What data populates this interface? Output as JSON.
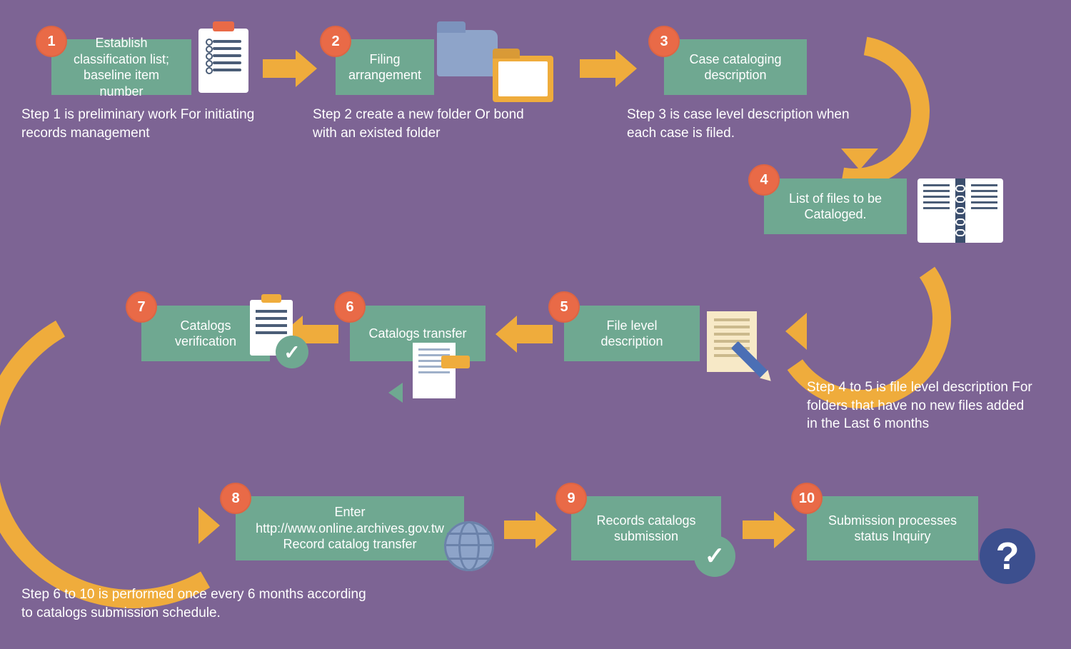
{
  "steps": {
    "s1": {
      "num": "1",
      "title": "Establish classification list; baseline item number",
      "caption": "Step 1 is preliminary work For initiating records management"
    },
    "s2": {
      "num": "2",
      "title": "Filing arrangement",
      "caption": "Step 2 create a new folder Or bond with an existed folder"
    },
    "s3": {
      "num": "3",
      "title": "Case cataloging description",
      "caption": "Step 3 is case level description when each case is filed."
    },
    "s4": {
      "num": "4",
      "title": "List of files to be Cataloged."
    },
    "s5": {
      "num": "5",
      "title": "File level description",
      "caption45": "Step 4 to 5 is file level description For folders that have no new files added in the Last 6 months"
    },
    "s6": {
      "num": "6",
      "title": "Catalogs transfer"
    },
    "s7": {
      "num": "7",
      "title": "Catalogs verification"
    },
    "s8": {
      "num": "8",
      "title": "Enter http://www.online.archives.gov.tw Record catalog transfer"
    },
    "s9": {
      "num": "9",
      "title": "Records catalogs submission"
    },
    "s10": {
      "num": "10",
      "title": "Submission processes status Inquiry"
    }
  },
  "footer": "Step 6 to 10 is performed once every 6 months according to catalogs submission schedule."
}
